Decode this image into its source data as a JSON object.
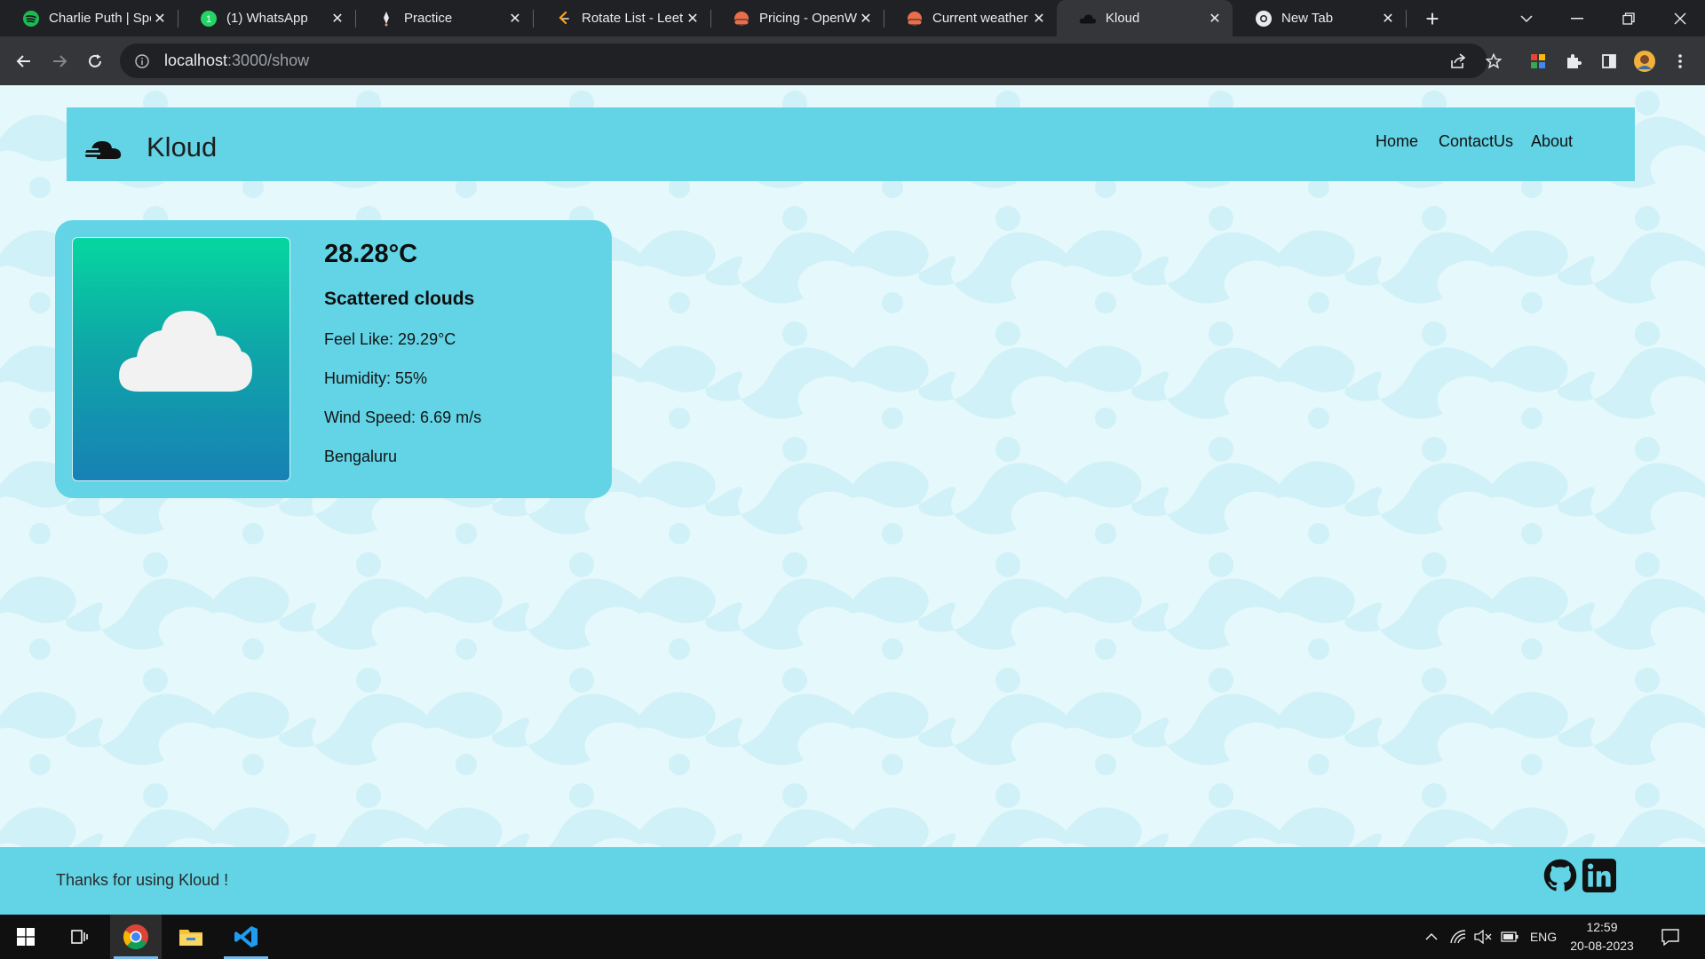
{
  "browser": {
    "tabs": [
      {
        "title": "Charlie Puth | Spo",
        "icon": "spotify-icon",
        "active": false
      },
      {
        "title": "(1) WhatsApp",
        "icon": "whatsapp-icon",
        "active": false
      },
      {
        "title": "Practice",
        "icon": "practice-icon",
        "active": false
      },
      {
        "title": "Rotate List - Leet",
        "icon": "leetcode-icon",
        "active": false
      },
      {
        "title": "Pricing - OpenWe",
        "icon": "openweather-icon",
        "active": false
      },
      {
        "title": "Current weather d",
        "icon": "openweather-icon",
        "active": false
      },
      {
        "title": "Kloud",
        "icon": "cloud-icon",
        "active": true
      },
      {
        "title": "New Tab",
        "icon": "chrome-icon",
        "active": false
      }
    ],
    "url_host": "localhost",
    "url_rest": ":3000/show"
  },
  "navbar": {
    "brand": "Kloud",
    "links": [
      "Home",
      "ContactUs",
      "About"
    ]
  },
  "weather": {
    "temperature": "28.28°C",
    "description": "Scattered clouds",
    "feels_like": "Feel Like: 29.29°C",
    "humidity": "Humidity: 55%",
    "wind_speed": "Wind Speed: 6.69 m/s",
    "city": "Bengaluru"
  },
  "footer": {
    "text": "Thanks for using Kloud !",
    "social_icons": [
      "github-icon",
      "linkedin-icon"
    ]
  },
  "taskbar": {
    "apps": [
      "windows-start-icon",
      "task-view-icon",
      "chrome-icon",
      "file-explorer-icon",
      "vscode-icon"
    ],
    "language": "ENG",
    "time": "12:59",
    "date": "20-08-2023"
  },
  "colors": {
    "accent": "#62d4e6",
    "page_background": "#e5f8fb",
    "card_gradient_top": "#06d6a0",
    "card_gradient_bottom": "#1781b5"
  }
}
